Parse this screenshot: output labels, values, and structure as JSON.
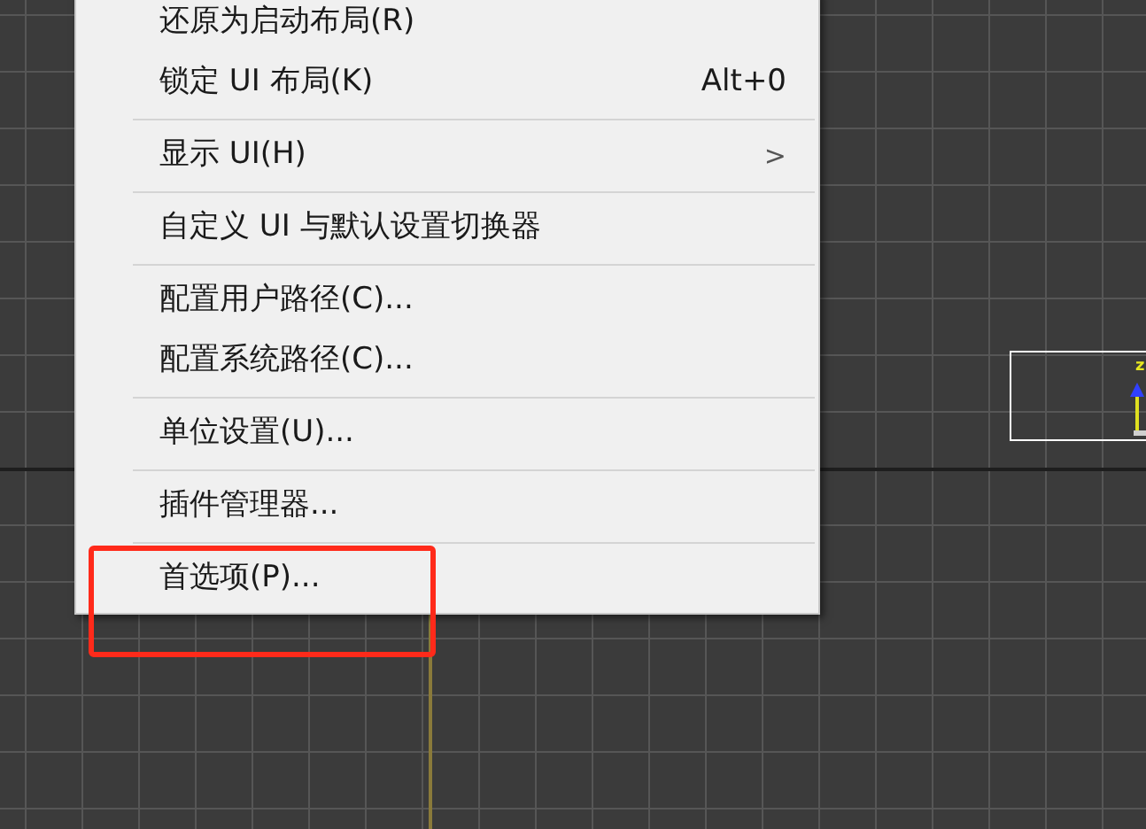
{
  "menu": {
    "items": [
      {
        "label": "还原为启动布局(R)",
        "separator_before": false,
        "annotated": false
      },
      {
        "label": "锁定 UI 布局(K)",
        "shortcut": "Alt+0",
        "separator_before": false,
        "annotated": false
      },
      {
        "label": "显示 UI(H)",
        "submenu_arrow": ">",
        "separator_before": true,
        "annotated": false
      },
      {
        "label": "自定义 UI 与默认设置切换器",
        "separator_before": true,
        "annotated": false
      },
      {
        "label": "配置用户路径(C)...",
        "separator_before": true,
        "annotated": false
      },
      {
        "label": "配置系统路径(C)...",
        "separator_before": false,
        "annotated": false
      },
      {
        "label": "单位设置(U)...",
        "separator_before": true,
        "annotated": false
      },
      {
        "label": "插件管理器...",
        "separator_before": true,
        "annotated": false
      },
      {
        "label": "首选项(P)...",
        "separator_before": true,
        "annotated": true
      }
    ]
  },
  "viewport": {
    "axis_label": "z"
  }
}
